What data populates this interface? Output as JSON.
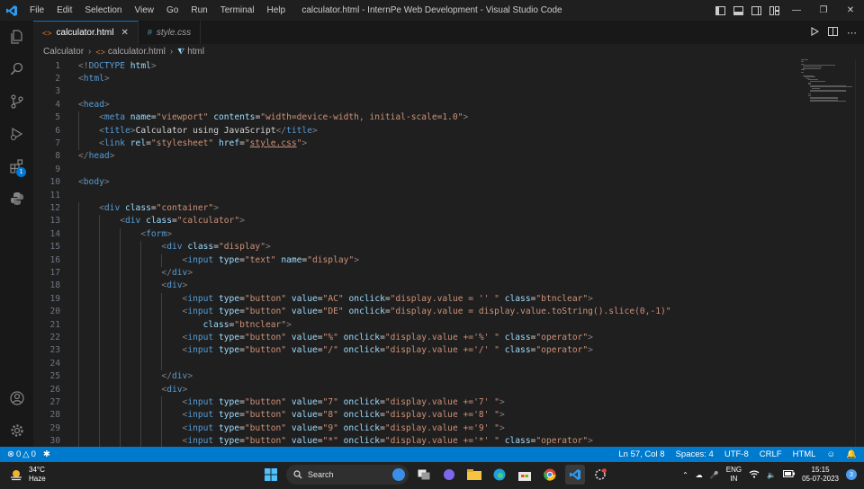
{
  "titlebar": {
    "menu": [
      "File",
      "Edit",
      "Selection",
      "View",
      "Go",
      "Run",
      "Terminal",
      "Help"
    ],
    "title": "calculator.html - InternPe Web Development - Visual Studio Code"
  },
  "activity_bar": {
    "items": [
      "explorer-icon",
      "search-icon",
      "source-control-icon",
      "run-debug-icon",
      "extensions-icon",
      "python-icon"
    ],
    "extensions_badge": "1",
    "bottom": [
      "account-icon",
      "manage-gear-icon"
    ]
  },
  "tabs": [
    {
      "label": "calculator.html",
      "icon": "<>",
      "active": true
    },
    {
      "label": "style.css",
      "icon": "#",
      "active": false
    }
  ],
  "breadcrumb": [
    "Calculator",
    "calculator.html",
    "html"
  ],
  "editor": {
    "lines": [
      {
        "n": "1",
        "t": "<!DOCTYPE html>"
      },
      {
        "n": "2",
        "t": "<html>"
      },
      {
        "n": "3",
        "t": ""
      },
      {
        "n": "4",
        "t": "<head>"
      },
      {
        "n": "5",
        "t": "    <meta name=\"viewport\" contents=\"width=device-width, initial-scale=1.0\">"
      },
      {
        "n": "6",
        "t": "    <title>Calculator using JavaScript</title>"
      },
      {
        "n": "7",
        "t": "    <link rel=\"stylesheet\" href=\"style.css\">"
      },
      {
        "n": "8",
        "t": "</head>"
      },
      {
        "n": "9",
        "t": ""
      },
      {
        "n": "10",
        "t": "<body>"
      },
      {
        "n": "11",
        "t": ""
      },
      {
        "n": "12",
        "t": "    <div class=\"container\">"
      },
      {
        "n": "13",
        "t": "        <div class=\"calculator\">"
      },
      {
        "n": "14",
        "t": "            <form>"
      },
      {
        "n": "15",
        "t": "                <div class=\"display\">"
      },
      {
        "n": "16",
        "t": "                    <input type=\"text\" name=\"display\">"
      },
      {
        "n": "17",
        "t": "                </div>"
      },
      {
        "n": "18",
        "t": "                <div>"
      },
      {
        "n": "19",
        "t": "                    <input type=\"button\" value=\"AC\" onclick=\"display.value = '' \" class=\"btnclear\">"
      },
      {
        "n": "20",
        "t": "                    <input type=\"button\" value=\"DE\" onclick=\"display.value = display.value.toString().slice(0,-1)\""
      },
      {
        "n": "21",
        "t": "                        class=\"btnclear\">"
      },
      {
        "n": "22",
        "t": "                    <input type=\"button\" value=\"%\" onclick=\"display.value +='%' \" class=\"operator\">"
      },
      {
        "n": "23",
        "t": "                    <input type=\"button\" value=\"/\" onclick=\"display.value +='/' \" class=\"operator\">"
      },
      {
        "n": "24",
        "t": ""
      },
      {
        "n": "25",
        "t": "                </div>"
      },
      {
        "n": "26",
        "t": "                <div>"
      },
      {
        "n": "27",
        "t": "                    <input type=\"button\" value=\"7\" onclick=\"display.value +='7' \">"
      },
      {
        "n": "28",
        "t": "                    <input type=\"button\" value=\"8\" onclick=\"display.value +='8' \">"
      },
      {
        "n": "29",
        "t": "                    <input type=\"button\" value=\"9\" onclick=\"display.value +='9' \">"
      },
      {
        "n": "30",
        "t": "                    <input type=\"button\" value=\"*\" onclick=\"display.value +='*' \" class=\"operator\">"
      }
    ]
  },
  "statusbar": {
    "errors": "0",
    "warnings": "0",
    "cursor": "Ln 57, Col 8",
    "spaces": "Spaces: 4",
    "encoding": "UTF-8",
    "eol": "CRLF",
    "language": "HTML"
  },
  "taskbar": {
    "weather_temp": "34°C",
    "weather_desc": "Haze",
    "search_label": "Search",
    "lang_line1": "ENG",
    "lang_line2": "IN",
    "time": "15:15",
    "date": "05-07-2023",
    "notification_count": "3"
  },
  "colors": {
    "accent": "#007acc",
    "tag": "#569cd6",
    "attribute": "#9cdcfe",
    "string": "#ce9178",
    "line_number": "#6e7681"
  }
}
